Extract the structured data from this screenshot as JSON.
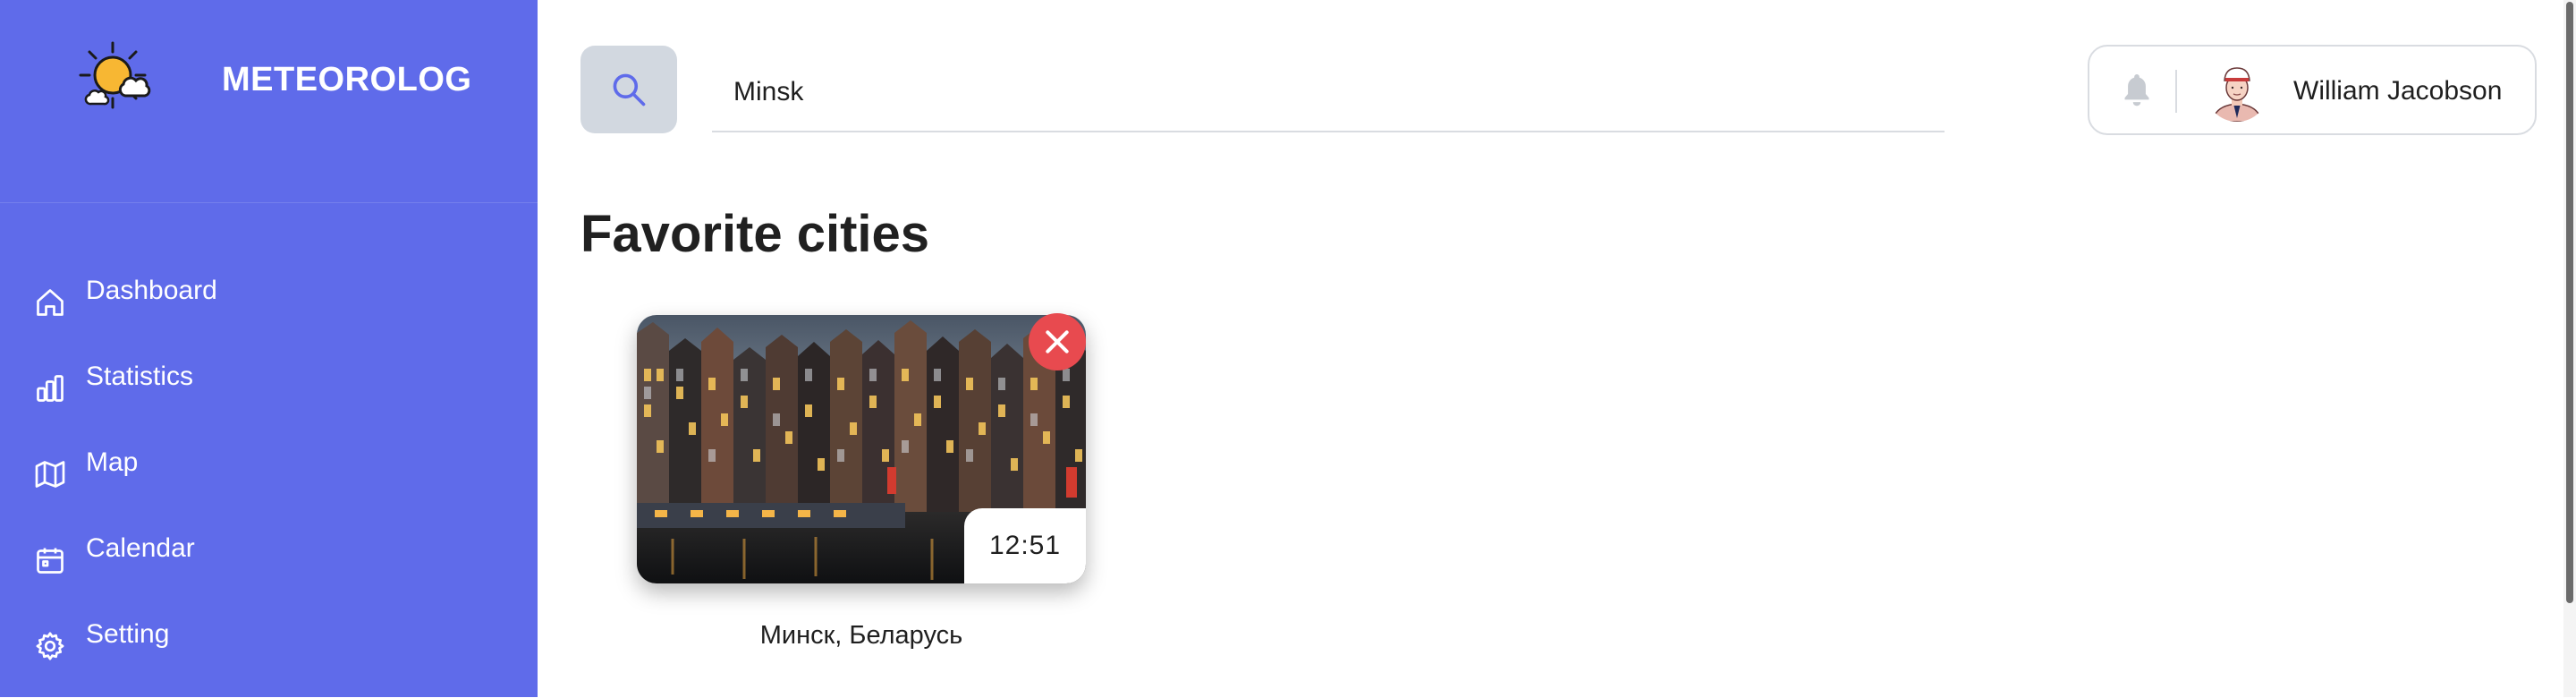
{
  "brand": {
    "name": "METEOROLOG",
    "logo_icon": "sun-cloud-icon",
    "sidebar_color": "#5f6bea"
  },
  "sidebar": {
    "items": [
      {
        "label": "Dashboard",
        "icon": "home-icon"
      },
      {
        "label": "Statistics",
        "icon": "bar-chart-icon"
      },
      {
        "label": "Map",
        "icon": "map-icon"
      },
      {
        "label": "Calendar",
        "icon": "calendar-icon"
      },
      {
        "label": "Setting",
        "icon": "gear-icon"
      }
    ]
  },
  "header": {
    "search_icon": "search-icon",
    "search_value": "Minsk",
    "notification_icon": "bell-icon",
    "user_name": "William Jacobson"
  },
  "main": {
    "title": "Favorite cities",
    "cities": [
      {
        "name": "Минск, Беларусь",
        "time": "12:51",
        "remove_icon": "close-icon",
        "remove_color": "#e84a4f"
      }
    ]
  }
}
